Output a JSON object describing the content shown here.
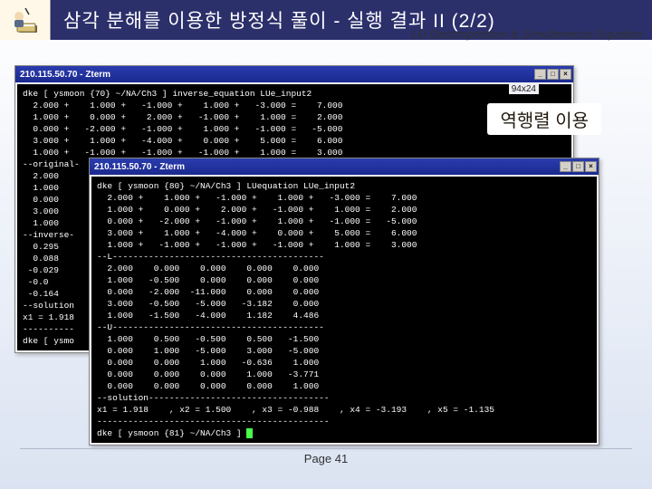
{
  "title": "삼각 분해를 이용한 방정식 풀이 - 실행 결과 II (2/2)",
  "subtitle": "LU Decomposition & Simultaneous Equation",
  "annotation": "역행렬 이용",
  "footer": "Page 41",
  "term1": {
    "title": "210.115.50.70 - Zterm",
    "dim": "94x24",
    "btn_min": "_",
    "btn_max": "□",
    "btn_close": "×",
    "lines": [
      "dke [ ysmoon {70} ~/NA/Ch3 ] inverse_equation LUe_input2",
      "  2.000 +    1.000 +   -1.000 +    1.000 +   -3.000 =    7.000",
      "  1.000 +    0.000 +    2.000 +   -1.000 +    1.000 =    2.000",
      "  0.000 +   -2.000 +   -1.000 +    1.000 +   -1.000 =   -5.000",
      "  3.000 +    1.000 +   -4.000 +    0.000 +    5.000 =    6.000",
      "  1.000 +   -1.000 +   -1.000 +   -1.000 +    1.000 =    3.000",
      "--original-",
      "  2.000",
      "  1.000",
      "  0.000",
      "  3.000",
      "  1.000",
      "--inverse-",
      "  0.295",
      "  0.088",
      " -0.029",
      " -0.0",
      " -0.164",
      "--solution",
      "x1 = 1.918",
      "----------",
      "dke [ ysmo"
    ]
  },
  "term2": {
    "title": "210.115.50.70 - Zterm",
    "btn_min": "_",
    "btn_max": "□",
    "btn_close": "×",
    "lines": [
      "dke [ ysmoon {80} ~/NA/Ch3 ] LUequation LUe_input2",
      "  2.000 +    1.000 +   -1.000 +    1.000 +   -3.000 =    7.000",
      "  1.000 +    0.000 +    2.000 +   -1.000 +    1.000 =    2.000",
      "  0.000 +   -2.000 +   -1.000 +    1.000 +   -1.000 =   -5.000",
      "  3.000 +    1.000 +   -4.000 +    0.000 +    5.000 =    6.000",
      "  1.000 +   -1.000 +   -1.000 +   -1.000 +    1.000 =    3.000",
      "--L-----------------------------------------",
      "  2.000    0.000    0.000    0.000    0.000",
      "  1.000   -0.500    0.000    0.000    0.000",
      "  0.000   -2.000  -11.000    0.000    0.000",
      "  3.000   -0.500   -5.000   -3.182    0.000",
      "  1.000   -1.500   -4.000    1.182    4.486",
      "--U-----------------------------------------",
      "  1.000    0.500   -0.500    0.500   -1.500",
      "  0.000    1.000   -5.000    3.000   -5.000",
      "  0.000    0.000    1.000   -0.636    1.000",
      "  0.000    0.000    0.000    1.000   -3.771",
      "  0.000    0.000    0.000    0.000    1.000",
      "--solution-----------------------------------",
      "x1 = 1.918    , x2 = 1.500    , x3 = -0.988    , x4 = -3.193    , x5 = -1.135",
      "---------------------------------------------"
    ],
    "prompt": "dke [ ysmoon {81} ~/NA/Ch3 ] "
  }
}
